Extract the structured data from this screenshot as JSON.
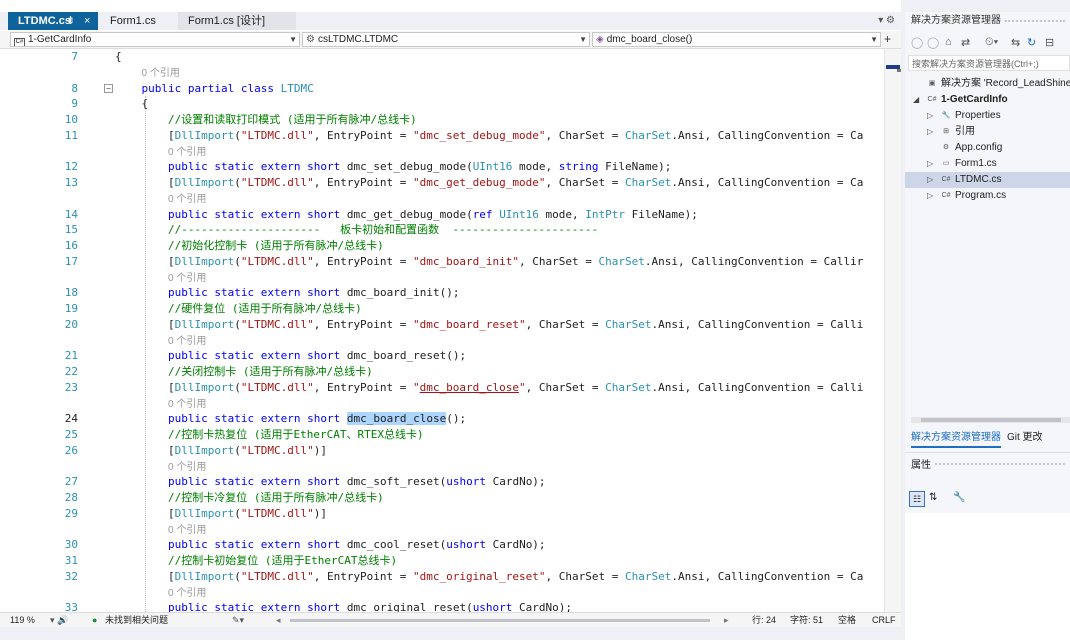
{
  "tabs": [
    {
      "label": "LTDMC.cs",
      "pin": "⇟",
      "close": "×"
    },
    {
      "label": "Form1.cs"
    },
    {
      "label": "Form1.cs [设计]"
    }
  ],
  "tabbar_controls": "▾  ⚙",
  "nav": {
    "project": "1-GetCardInfo",
    "class": "csLTDMC.LTDMC",
    "member": "dmc_board_close()",
    "add": "+"
  },
  "code_lines": [
    {
      "n": "7",
      "html": "{",
      "fold": false
    },
    {
      "n": "",
      "html": "    <span class='ref'>0 个引用</span>"
    },
    {
      "n": "8",
      "html": "    <span class='kw'>public</span> <span class='kw'>partial</span> <span class='kw'>class</span> <span class='ty'>LTDMC</span>",
      "fold": true
    },
    {
      "n": "9",
      "html": "    {"
    },
    {
      "n": "10",
      "html": "        <span class='cm'>//设置和读取打印模式 (适用于所有脉冲/总线卡)</span>"
    },
    {
      "n": "11",
      "html": "        [<span class='ty'>DllImport</span>(<span class='st'>\"LTDMC.dll\"</span>, EntryPoint = <span class='st'>\"dmc_set_debug_mode\"</span>, CharSet = <span class='ty'>CharSet</span>.Ansi, CallingConvention = Ca"
    },
    {
      "n": "",
      "html": "        <span class='ref'>0 个引用</span>"
    },
    {
      "n": "12",
      "html": "        <span class='kw'>public</span> <span class='kw'>static</span> <span class='kw'>extern</span> <span class='kw'>short</span> dmc_set_debug_mode(<span class='ty'>UInt16</span> mode, <span class='kw'>string</span> FileName);"
    },
    {
      "n": "13",
      "html": "        [<span class='ty'>DllImport</span>(<span class='st'>\"LTDMC.dll\"</span>, EntryPoint = <span class='st'>\"dmc_get_debug_mode\"</span>, CharSet = <span class='ty'>CharSet</span>.Ansi, CallingConvention = Ca"
    },
    {
      "n": "",
      "html": "        <span class='ref'>0 个引用</span>"
    },
    {
      "n": "14",
      "html": "        <span class='kw'>public</span> <span class='kw'>static</span> <span class='kw'>extern</span> <span class='kw'>short</span> dmc_get_debug_mode(<span class='kw'>ref</span> <span class='ty'>UInt16</span> mode, <span class='ty'>IntPtr</span> FileName);"
    },
    {
      "n": "15",
      "html": "        <span class='cm'>//---------------------   板卡初始和配置函数  ----------------------</span>"
    },
    {
      "n": "16",
      "html": "        <span class='cm'>//初始化控制卡 (适用于所有脉冲/总线卡)</span>"
    },
    {
      "n": "17",
      "html": "        [<span class='ty'>DllImport</span>(<span class='st'>\"LTDMC.dll\"</span>, EntryPoint = <span class='st'>\"dmc_board_init\"</span>, CharSet = <span class='ty'>CharSet</span>.Ansi, CallingConvention = Callir"
    },
    {
      "n": "",
      "html": "        <span class='ref'>0 个引用</span>"
    },
    {
      "n": "18",
      "html": "        <span class='kw'>public</span> <span class='kw'>static</span> <span class='kw'>extern</span> <span class='kw'>short</span> dmc_board_init();"
    },
    {
      "n": "19",
      "html": "        <span class='cm'>//硬件复位 (适用于所有脉冲/总线卡)</span>"
    },
    {
      "n": "20",
      "html": "        [<span class='ty'>DllImport</span>(<span class='st'>\"LTDMC.dll\"</span>, EntryPoint = <span class='st'>\"dmc_board_reset\"</span>, CharSet = <span class='ty'>CharSet</span>.Ansi, CallingConvention = Calli"
    },
    {
      "n": "",
      "html": "        <span class='ref'>0 个引用</span>"
    },
    {
      "n": "21",
      "html": "        <span class='kw'>public</span> <span class='kw'>static</span> <span class='kw'>extern</span> <span class='kw'>short</span> dmc_board_reset();"
    },
    {
      "n": "22",
      "html": "        <span class='cm'>//关闭控制卡 (适用于所有脉冲/总线卡)</span>"
    },
    {
      "n": "23",
      "html": "        [<span class='ty'>DllImport</span>(<span class='st'>\"LTDMC.dll\"</span>, EntryPoint = <span class='st'>\"<span style='text-decoration:underline'>dmc_board_close</span>\"</span>, CharSet = <span class='ty'>CharSet</span>.Ansi, CallingConvention = Calli"
    },
    {
      "n": "",
      "html": "        <span class='ref'>0 个引用</span>"
    },
    {
      "n": "24",
      "html": "        <span class='kw'>public</span> <span class='kw'>static</span> <span class='kw'>extern</span> <span class='kw'>short</span> <span class='hl'>dmc_board_close</span>();",
      "cur": true
    },
    {
      "n": "25",
      "html": "        <span class='cm'>//控制卡热复位 (适用于EtherCAT、RTEX总线卡)</span>"
    },
    {
      "n": "26",
      "html": "        [<span class='ty'>DllImport</span>(<span class='st'>\"LTDMC.dll\"</span>)]"
    },
    {
      "n": "",
      "html": "        <span class='ref'>0 个引用</span>"
    },
    {
      "n": "27",
      "html": "        <span class='kw'>public</span> <span class='kw'>static</span> <span class='kw'>extern</span> <span class='kw'>short</span> dmc_soft_reset(<span class='kw'>ushort</span> CardNo);"
    },
    {
      "n": "28",
      "html": "        <span class='cm'>//控制卡冷复位 (适用于所有脉冲/总线卡)</span>"
    },
    {
      "n": "29",
      "html": "        [<span class='ty'>DllImport</span>(<span class='st'>\"LTDMC.dll\"</span>)]"
    },
    {
      "n": "",
      "html": "        <span class='ref'>0 个引用</span>"
    },
    {
      "n": "30",
      "html": "        <span class='kw'>public</span> <span class='kw'>static</span> <span class='kw'>extern</span> <span class='kw'>short</span> dmc_cool_reset(<span class='kw'>ushort</span> CardNo);"
    },
    {
      "n": "31",
      "html": "        <span class='cm'>//控制卡初始复位 (适用于EtherCAT总线卡)</span>"
    },
    {
      "n": "32",
      "html": "        [<span class='ty'>DllImport</span>(<span class='st'>\"LTDMC.dll\"</span>, EntryPoint = <span class='st'>\"dmc_original_reset\"</span>, CharSet = <span class='ty'>CharSet</span>.Ansi, CallingConvention = Ca"
    },
    {
      "n": "",
      "html": "        <span class='ref'>0 个引用</span>"
    },
    {
      "n": "33",
      "html": "        <span class='kw'>public</span> <span class='kw'>static</span> <span class='kw'>extern</span> <span class='kw'>short</span> dmc_original_reset(<span class='kw'>ushort</span> CardNo);"
    }
  ],
  "status": {
    "zoom": "119 %",
    "issues": "未找到相关问题",
    "line": "行: 24",
    "col": "字符: 51",
    "space": "空格",
    "eol": "CRLF"
  },
  "solution_explorer": {
    "title": "解决方案资源管理器",
    "search_placeholder": "搜索解决方案资源管理器(Ctrl+;)",
    "items": [
      {
        "label": "解决方案 'Record_LeadShine_",
        "icon": "▣",
        "exp": ""
      },
      {
        "label": "1-GetCardInfo",
        "icon": "C#",
        "exp": "◢",
        "bold": true
      },
      {
        "label": "Properties",
        "icon": "🔧",
        "exp": "▷"
      },
      {
        "label": "引用",
        "icon": "⊞",
        "exp": "▷"
      },
      {
        "label": "App.config",
        "icon": "⚙",
        "exp": ""
      },
      {
        "label": "Form1.cs",
        "icon": "▭",
        "exp": "▷"
      },
      {
        "label": "LTDMC.cs",
        "icon": "C#",
        "exp": "▷",
        "sel": true
      },
      {
        "label": "Program.cs",
        "icon": "C#",
        "exp": "▷"
      }
    ],
    "tab_active": "解决方案资源管理器",
    "tab_other": "Git 更改"
  },
  "properties": {
    "title": "属性"
  }
}
